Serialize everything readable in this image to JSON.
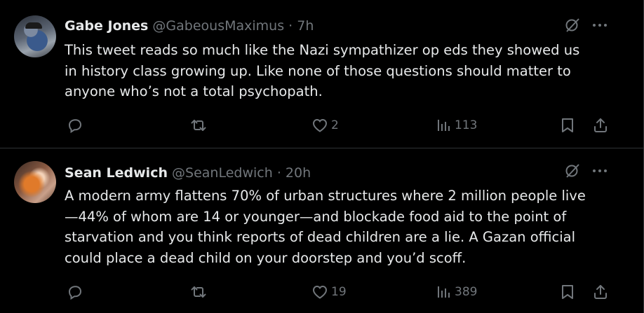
{
  "tweets": [
    {
      "name": "Gabe Jones",
      "handle": "@GabeousMaximus",
      "dot": "·",
      "time": "7h",
      "text": "This tweet reads so much like the Nazi sympathizer op eds they showed us\nin history class growing up. Like none of those questions should matter to\nanyone who’s not a total psychopath.",
      "reply_count": "",
      "retweet_count": "",
      "like_count": "2",
      "view_count": "113"
    },
    {
      "name": "Sean Ledwich",
      "handle": "@SeanLedwich",
      "dot": "·",
      "time": "20h",
      "text": "A modern army flattens 70% of urban structures where 2 million people live\n—44% of whom are 14 or younger—and blockade food aid to the point of\nstarvation and you think reports of dead children are a lie. A Gazan official\ncould place a dead child on your doorstep and you’d scoff.",
      "reply_count": "",
      "retweet_count": "",
      "like_count": "19",
      "view_count": "389"
    }
  ],
  "icons": {
    "reply": "reply-icon",
    "retweet": "retweet-icon",
    "like": "heart-icon",
    "views": "views-icon",
    "bookmark": "bookmark-icon",
    "share": "share-icon",
    "grok": "grok-icon",
    "more": "more-icon"
  },
  "colors": {
    "background": "#000000",
    "text": "#e7e9ea",
    "muted": "#71767b",
    "border": "#2f3336"
  }
}
